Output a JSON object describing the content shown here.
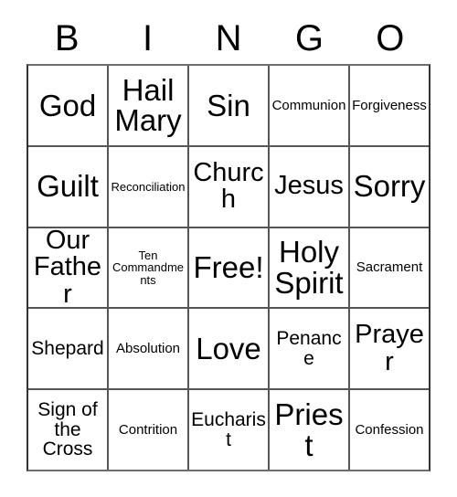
{
  "card": {
    "header_letters": [
      "B",
      "I",
      "N",
      "G",
      "O"
    ],
    "rows": [
      [
        {
          "text": "God",
          "size": "xl"
        },
        {
          "text": "Hail Mary",
          "size": "xl"
        },
        {
          "text": "Sin",
          "size": "xl"
        },
        {
          "text": "Communion",
          "size": "sm"
        },
        {
          "text": "Forgiveness",
          "size": "sm"
        }
      ],
      [
        {
          "text": "Guilt",
          "size": "xl"
        },
        {
          "text": "Reconciliation",
          "size": "xs"
        },
        {
          "text": "Church",
          "size": "lg"
        },
        {
          "text": "Jesus",
          "size": "lg"
        },
        {
          "text": "Sorry",
          "size": "xl"
        }
      ],
      [
        {
          "text": "Our Father",
          "size": "lg"
        },
        {
          "text": "Ten Commandments",
          "size": "xs"
        },
        {
          "text": "Free!",
          "size": "xl"
        },
        {
          "text": "Holy Spirit",
          "size": "xl"
        },
        {
          "text": "Sacrament",
          "size": "sm"
        }
      ],
      [
        {
          "text": "Shepard",
          "size": "md"
        },
        {
          "text": "Absolution",
          "size": "sm"
        },
        {
          "text": "Love",
          "size": "xl"
        },
        {
          "text": "Penance",
          "size": "md"
        },
        {
          "text": "Prayer",
          "size": "lg"
        }
      ],
      [
        {
          "text": "Sign of the Cross",
          "size": "md"
        },
        {
          "text": "Contrition",
          "size": "sm"
        },
        {
          "text": "Eucharist",
          "size": "md"
        },
        {
          "text": "Priest",
          "size": "xl"
        },
        {
          "text": "Confession",
          "size": "sm"
        }
      ]
    ]
  },
  "colors": {
    "background": "#ffffff",
    "text": "#000000",
    "grid_line": "#555555"
  }
}
